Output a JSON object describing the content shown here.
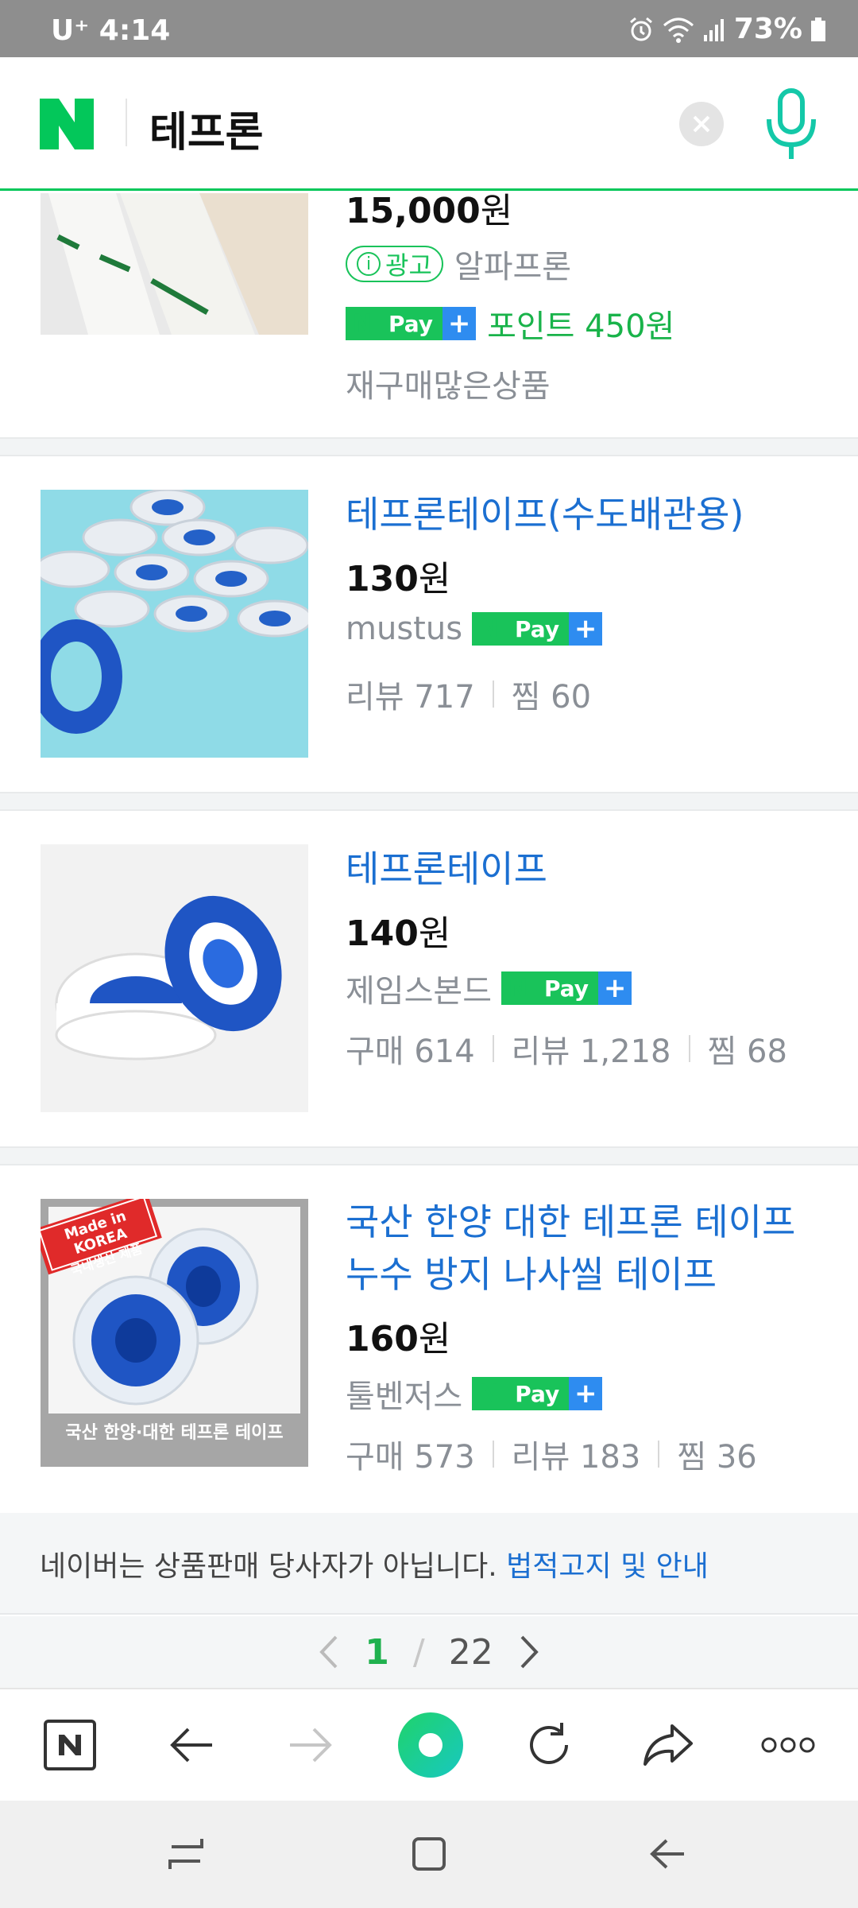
{
  "status_bar": {
    "carrier": "U⁺ 4:14",
    "battery": "73%"
  },
  "search": {
    "query": "테프론"
  },
  "products": [
    {
      "price_num": "15,000",
      "price_unit": "원",
      "ad_label": "광고",
      "seller": "알파프론",
      "points": "포인트 450원",
      "tag": "재구매많은상품"
    },
    {
      "title": "테프론테이프(수도배관용)",
      "price_num": "130",
      "price_unit": "원",
      "seller": "mustus",
      "review_label": "리뷰 717",
      "wish_label": "찜 60"
    },
    {
      "title": "테프론테이프",
      "price_num": "140",
      "price_unit": "원",
      "seller": "제임스본드",
      "purchase_label": "구매 614",
      "review_label": "리뷰 1,218",
      "wish_label": "찜 68"
    },
    {
      "title_line1": "국산 한양 대한 테프론 테이프",
      "title_line2": "누수 방지 나사씰 테이프",
      "price_num": "160",
      "price_unit": "원",
      "seller": "툴벤저스",
      "purchase_label": "구매 573",
      "review_label": "리뷰 183",
      "wish_label": "찜 36",
      "image_banner": "Made in KOREA",
      "image_banner_sub": "국내생산 제품",
      "image_caption": "국산 한양·대한 테프론 테이프"
    }
  ],
  "npay": {
    "n": "N",
    "pay": "Pay",
    "plus": "+"
  },
  "notice": {
    "text": "네이버는 상품판매 당사자가 아닙니다. ",
    "link": "법적고지 및 안내"
  },
  "pager": {
    "current": "1",
    "slash": "/",
    "total": "22"
  },
  "colors": {
    "naver_green": "#03c75a",
    "link_blue": "#1b6fd1",
    "npay_blue": "#2e8cf0"
  }
}
